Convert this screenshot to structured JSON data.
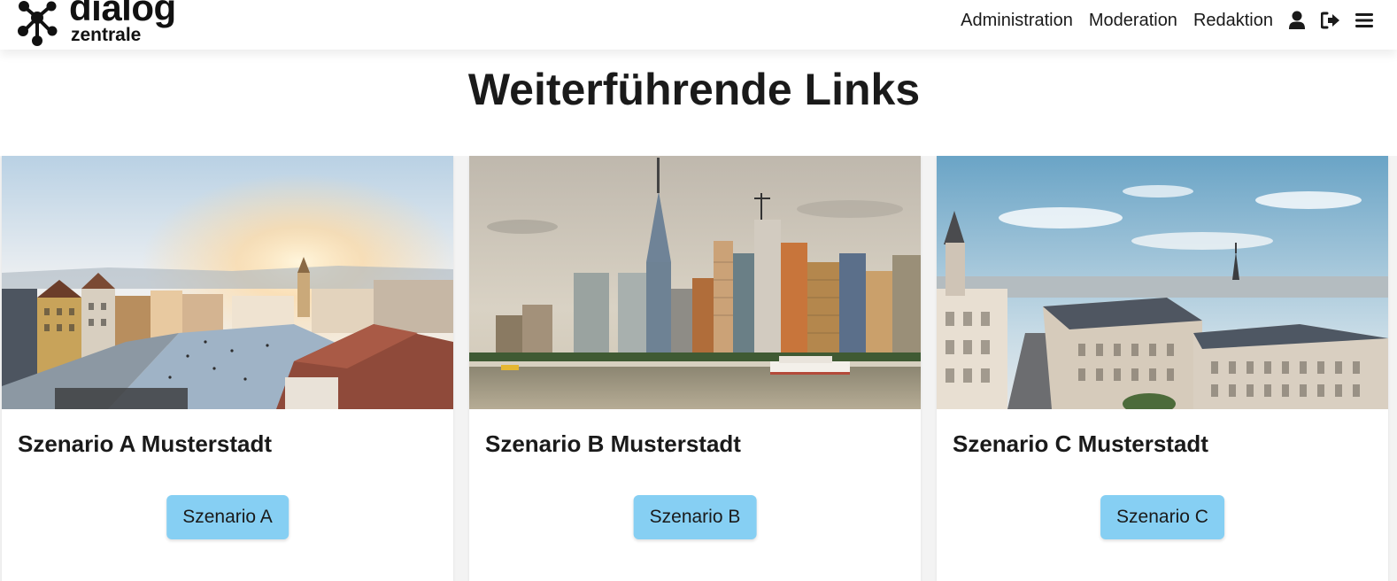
{
  "brand": {
    "name": "dialog",
    "sub": "zentrale"
  },
  "nav": {
    "items": [
      {
        "label": "Administration"
      },
      {
        "label": "Moderation"
      },
      {
        "label": "Redaktion"
      }
    ],
    "icons": [
      "user-icon",
      "sign-out-icon",
      "menu-icon"
    ]
  },
  "page": {
    "title": "Weiterführende Links"
  },
  "cards": [
    {
      "title": "Szenario A Musterstadt",
      "button": "Szenario A",
      "image": "old-town-square-photo"
    },
    {
      "title": "Szenario B Musterstadt",
      "button": "Szenario B",
      "image": "city-skyline-photo"
    },
    {
      "title": "Szenario C Musterstadt",
      "button": "Szenario C",
      "image": "paris-rooftops-photo"
    }
  ],
  "colors": {
    "button": "#86cff3",
    "text": "#1a1a1a",
    "background": "#ffffff"
  }
}
